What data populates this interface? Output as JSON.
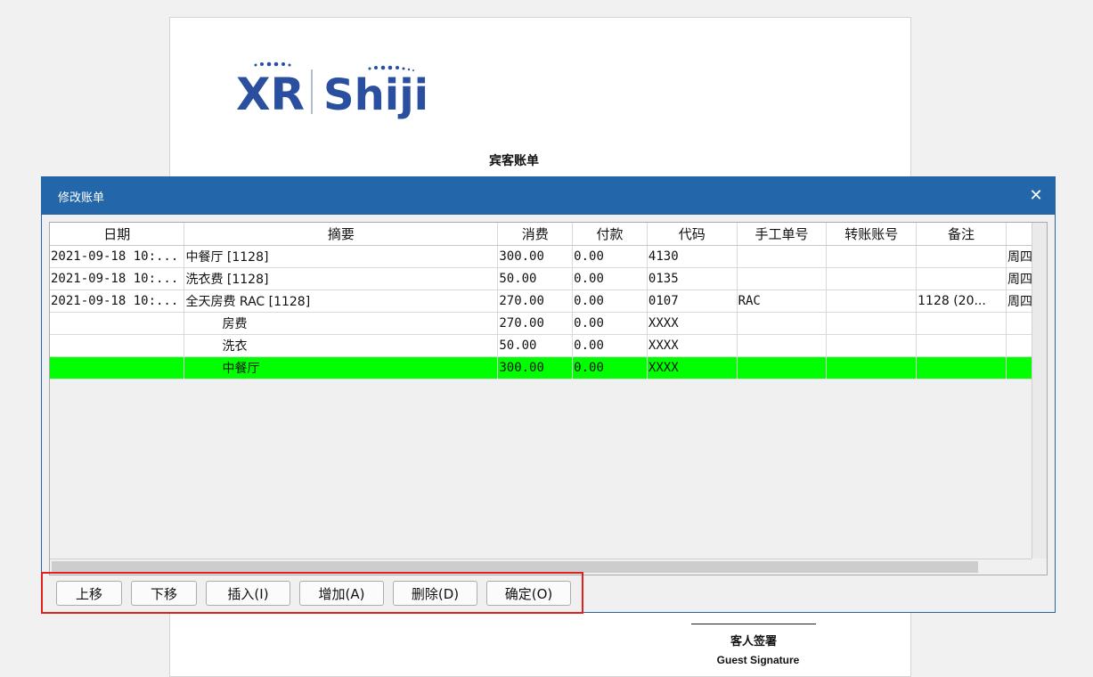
{
  "document": {
    "logo_text_left": "XR",
    "logo_text_right": "Shiji",
    "title": "宾客账单",
    "signature_cn": "客人签署",
    "signature_en": "Guest Signature"
  },
  "dialog": {
    "title": "修改账单",
    "close_symbol": "✕",
    "columns": [
      "日期",
      "摘要",
      "消费",
      "付款",
      "代码",
      "手工单号",
      "转账账号",
      "备注",
      ""
    ],
    "rows": [
      {
        "date": "2021-09-18 10:...",
        "summary": "中餐厅  [1128]",
        "charge": "300.00",
        "payment": "0.00",
        "code": "4130",
        "manual_no": "",
        "transfer_acct": "",
        "remark": "",
        "extra": "周四"
      },
      {
        "date": "2021-09-18 10:...",
        "summary": "洗衣费  [1128]",
        "charge": "50.00",
        "payment": "0.00",
        "code": "0135",
        "manual_no": "",
        "transfer_acct": "",
        "remark": "",
        "extra": "周四"
      },
      {
        "date": "2021-09-18 10:...",
        "summary": "全天房费  RAC [1128]",
        "charge": "270.00",
        "payment": "0.00",
        "code": "0107",
        "manual_no": "RAC",
        "transfer_acct": "",
        "remark": "1128 (20...",
        "extra": "周四"
      },
      {
        "date": "",
        "summary": "房费",
        "charge": "270.00",
        "payment": "0.00",
        "code": "XXXX",
        "manual_no": "",
        "transfer_acct": "",
        "remark": "",
        "extra": ""
      },
      {
        "date": "",
        "summary": "洗衣",
        "charge": "50.00",
        "payment": "0.00",
        "code": "XXXX",
        "manual_no": "",
        "transfer_acct": "",
        "remark": "",
        "extra": ""
      },
      {
        "date": "",
        "summary": "中餐厅",
        "charge": "300.00",
        "payment": "0.00",
        "code": "XXXX",
        "manual_no": "",
        "transfer_acct": "",
        "remark": "",
        "extra": ""
      }
    ],
    "buttons": {
      "move_up": "上移",
      "move_down": "下移",
      "insert": "插入(I)",
      "add": "增加(A)",
      "delete": "删除(D)",
      "confirm": "确定(O)"
    }
  },
  "colors": {
    "titlebar": "#2466aa",
    "selected_row": "#00ff00",
    "highlight_box": "#e01f1f",
    "logo_blue": "#2a4f9e"
  }
}
